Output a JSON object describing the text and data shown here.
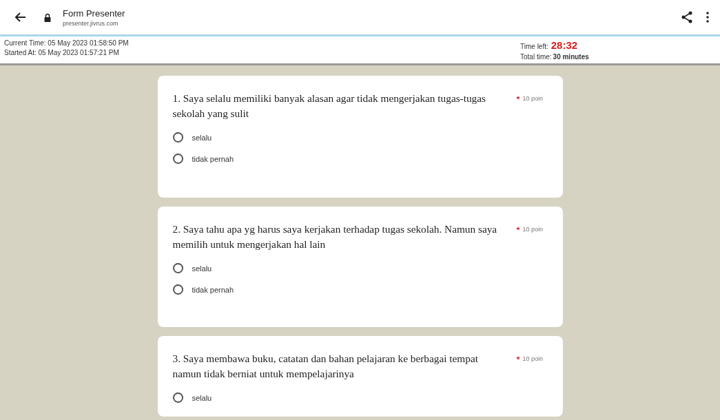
{
  "app_bar": {
    "title": "Form Presenter",
    "url": "presenter.jivrus.com"
  },
  "header": {
    "current_time": "Current Time: 05 May 2023 01:58:50 PM",
    "started_at": "Started At: 05 May 2023 01:57:21 PM",
    "time_left_label": "Time left:",
    "time_left": "28:32",
    "total_time_label": "Total time:",
    "total_time": "30 minutes"
  },
  "questions": [
    {
      "text": "1. Saya selalu memiliki banyak alasan agar tidak mengerjakan tugas-tugas sekolah yang sulit",
      "required": true,
      "points": "10 poin",
      "options": [
        {
          "label": "selalu",
          "selected": false
        },
        {
          "label": "tidak pernah",
          "selected": false
        }
      ]
    },
    {
      "text": "2. Saya tahu apa yg harus saya kerjakan terhadap tugas sekolah. Namun saya memilih untuk mengerjakan hal lain",
      "required": true,
      "points": "10 poin",
      "options": [
        {
          "label": "selalu",
          "selected": false
        },
        {
          "label": "tidak pernah",
          "selected": false
        }
      ]
    },
    {
      "text": "3. Saya membawa buku, catatan dan bahan pelajaran ke berbagai tempat namun tidak berniat untuk mempelajarinya",
      "required": true,
      "points": "10 poin",
      "options": [
        {
          "label": "selalu",
          "selected": false
        }
      ]
    }
  ]
}
